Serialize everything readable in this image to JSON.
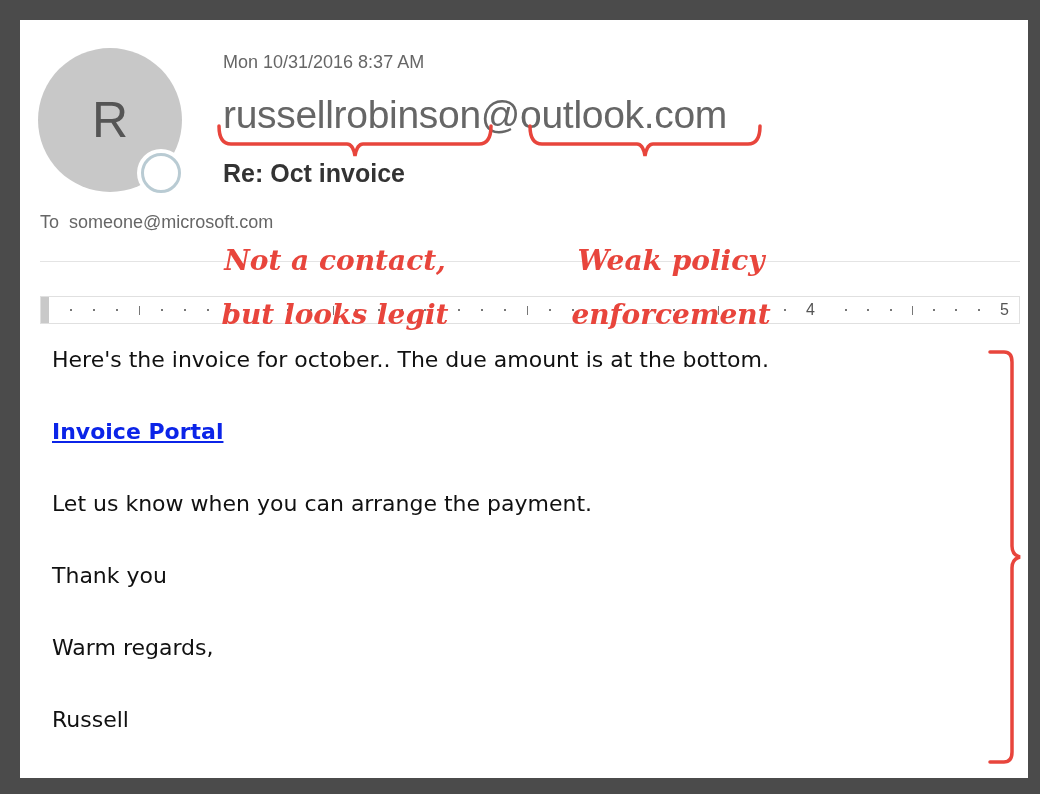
{
  "message": {
    "avatar_initial": "R",
    "date": "Mon 10/31/2016 8:37 AM",
    "sender_name": "russellrobinson",
    "sender_domain": "@outlook.com",
    "subject": "Re: Oct invoice",
    "to_label": "To",
    "to": "someone@microsoft.com"
  },
  "ruler": {
    "labels": [
      "4",
      "5"
    ]
  },
  "body": [
    {
      "kind": "text",
      "text": "Here's the invoice for october.. The due amount is at the bottom."
    },
    {
      "kind": "link",
      "text": "Invoice Portal"
    },
    {
      "kind": "text",
      "text": "Let us know when you can arrange the payment."
    },
    {
      "kind": "text",
      "text": "Thank you"
    },
    {
      "kind": "text",
      "text": "Warm regards,"
    },
    {
      "kind": "text",
      "text": "Russell"
    }
  ],
  "annotations": [
    "Not a contact, but looks legit",
    "Weak policy enforcement"
  ]
}
